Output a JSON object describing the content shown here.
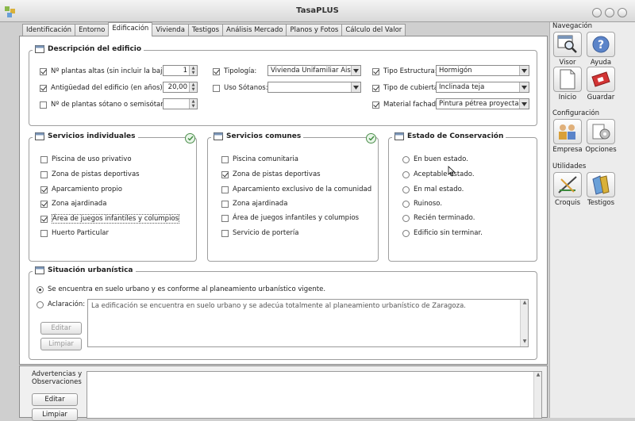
{
  "window": {
    "title": "TasaPLUS"
  },
  "tabs": [
    {
      "label": "Identificación"
    },
    {
      "label": "Entorno"
    },
    {
      "label": "Edificación"
    },
    {
      "label": "Vivienda"
    },
    {
      "label": "Testigos"
    },
    {
      "label": "Análisis Mercado"
    },
    {
      "label": "Planos y Fotos"
    },
    {
      "label": "Cálculo del Valor"
    }
  ],
  "descripcion": {
    "title": "Descripción del edificio",
    "plantas_altas": {
      "label": "Nº plantas altas (sin incluir la baja):",
      "value": "1",
      "checked": true
    },
    "antiguedad": {
      "label": "Antigüedad del edificio (en años):",
      "value": "20,00",
      "checked": true
    },
    "plantas_sotano": {
      "label": "Nº de plantas sótano o semisótano:",
      "value": "",
      "checked": false
    },
    "tipologia": {
      "label": "Tipología:",
      "value": "Vivienda Unifamiliar Aislada",
      "checked": true
    },
    "uso_sotanos": {
      "label": "Uso Sótanos:",
      "value": "",
      "checked": false
    },
    "tipo_estructura": {
      "label": "Tipo Estructura:",
      "value": "Hormigón",
      "checked": true
    },
    "tipo_cubierta": {
      "label": "Tipo de cubierta:",
      "value": "Inclinada teja",
      "checked": true
    },
    "material_fachada": {
      "label": "Material fachada:",
      "value": "Pintura pétrea proyectada",
      "checked": true
    }
  },
  "servicios_individuales": {
    "title": "Servicios individuales",
    "items": [
      {
        "label": "Piscina de uso privativo",
        "checked": false
      },
      {
        "label": "Zona de pistas deportivas",
        "checked": false
      },
      {
        "label": "Aparcamiento propio",
        "checked": true
      },
      {
        "label": "Zona ajardinada",
        "checked": true
      },
      {
        "label": "Área de juegos infantiles y columpios",
        "checked": true
      },
      {
        "label": "Huerto Particular",
        "checked": false
      }
    ]
  },
  "servicios_comunes": {
    "title": "Servicios comunes",
    "items": [
      {
        "label": "Piscina comunitaria",
        "checked": false
      },
      {
        "label": "Zona de pistas deportivas",
        "checked": true
      },
      {
        "label": "Aparcamiento exclusivo de la comunidad",
        "checked": false
      },
      {
        "label": "Zona ajardinada",
        "checked": false
      },
      {
        "label": "Área de juegos infantiles y columpios",
        "checked": false
      },
      {
        "label": "Servicio de portería",
        "checked": false
      }
    ]
  },
  "estado": {
    "title": "Estado de Conservación",
    "items": [
      {
        "label": "En buen estado.",
        "checked": false
      },
      {
        "label": "Aceptable estado.",
        "checked": false
      },
      {
        "label": "En mal estado.",
        "checked": false
      },
      {
        "label": "Ruinoso.",
        "checked": false
      },
      {
        "label": "Recién terminado.",
        "checked": false
      },
      {
        "label": "Edificio sin terminar.",
        "checked": false
      }
    ]
  },
  "situacion": {
    "title": "Situación urbanística",
    "option1": "Se encuentra en suelo urbano y es conforme al planeamiento urbanístico vigente.",
    "option2": "Aclaración:",
    "aclaracion_text": "La edificación se encuentra en suelo urbano y se adecúa totalmente al planeamiento urbanístico de Zaragoza.",
    "editar": "Editar",
    "limpiar": "Limpiar"
  },
  "advertencias": {
    "label_line1": "Advertencias y",
    "label_line2": "Observaciones",
    "editar": "Editar",
    "limpiar": "Limpiar"
  },
  "sidebar": {
    "navegacion": "Navegación",
    "configuracion": "Configuración",
    "utilidades": "Utilidades",
    "visor": "Visor",
    "ayuda": "Ayuda",
    "inicio": "Inicio",
    "guardar": "Guardar",
    "empresa": "Empresa",
    "opciones": "Opciones",
    "croquis": "Croquis",
    "testigos": "Testigos"
  }
}
